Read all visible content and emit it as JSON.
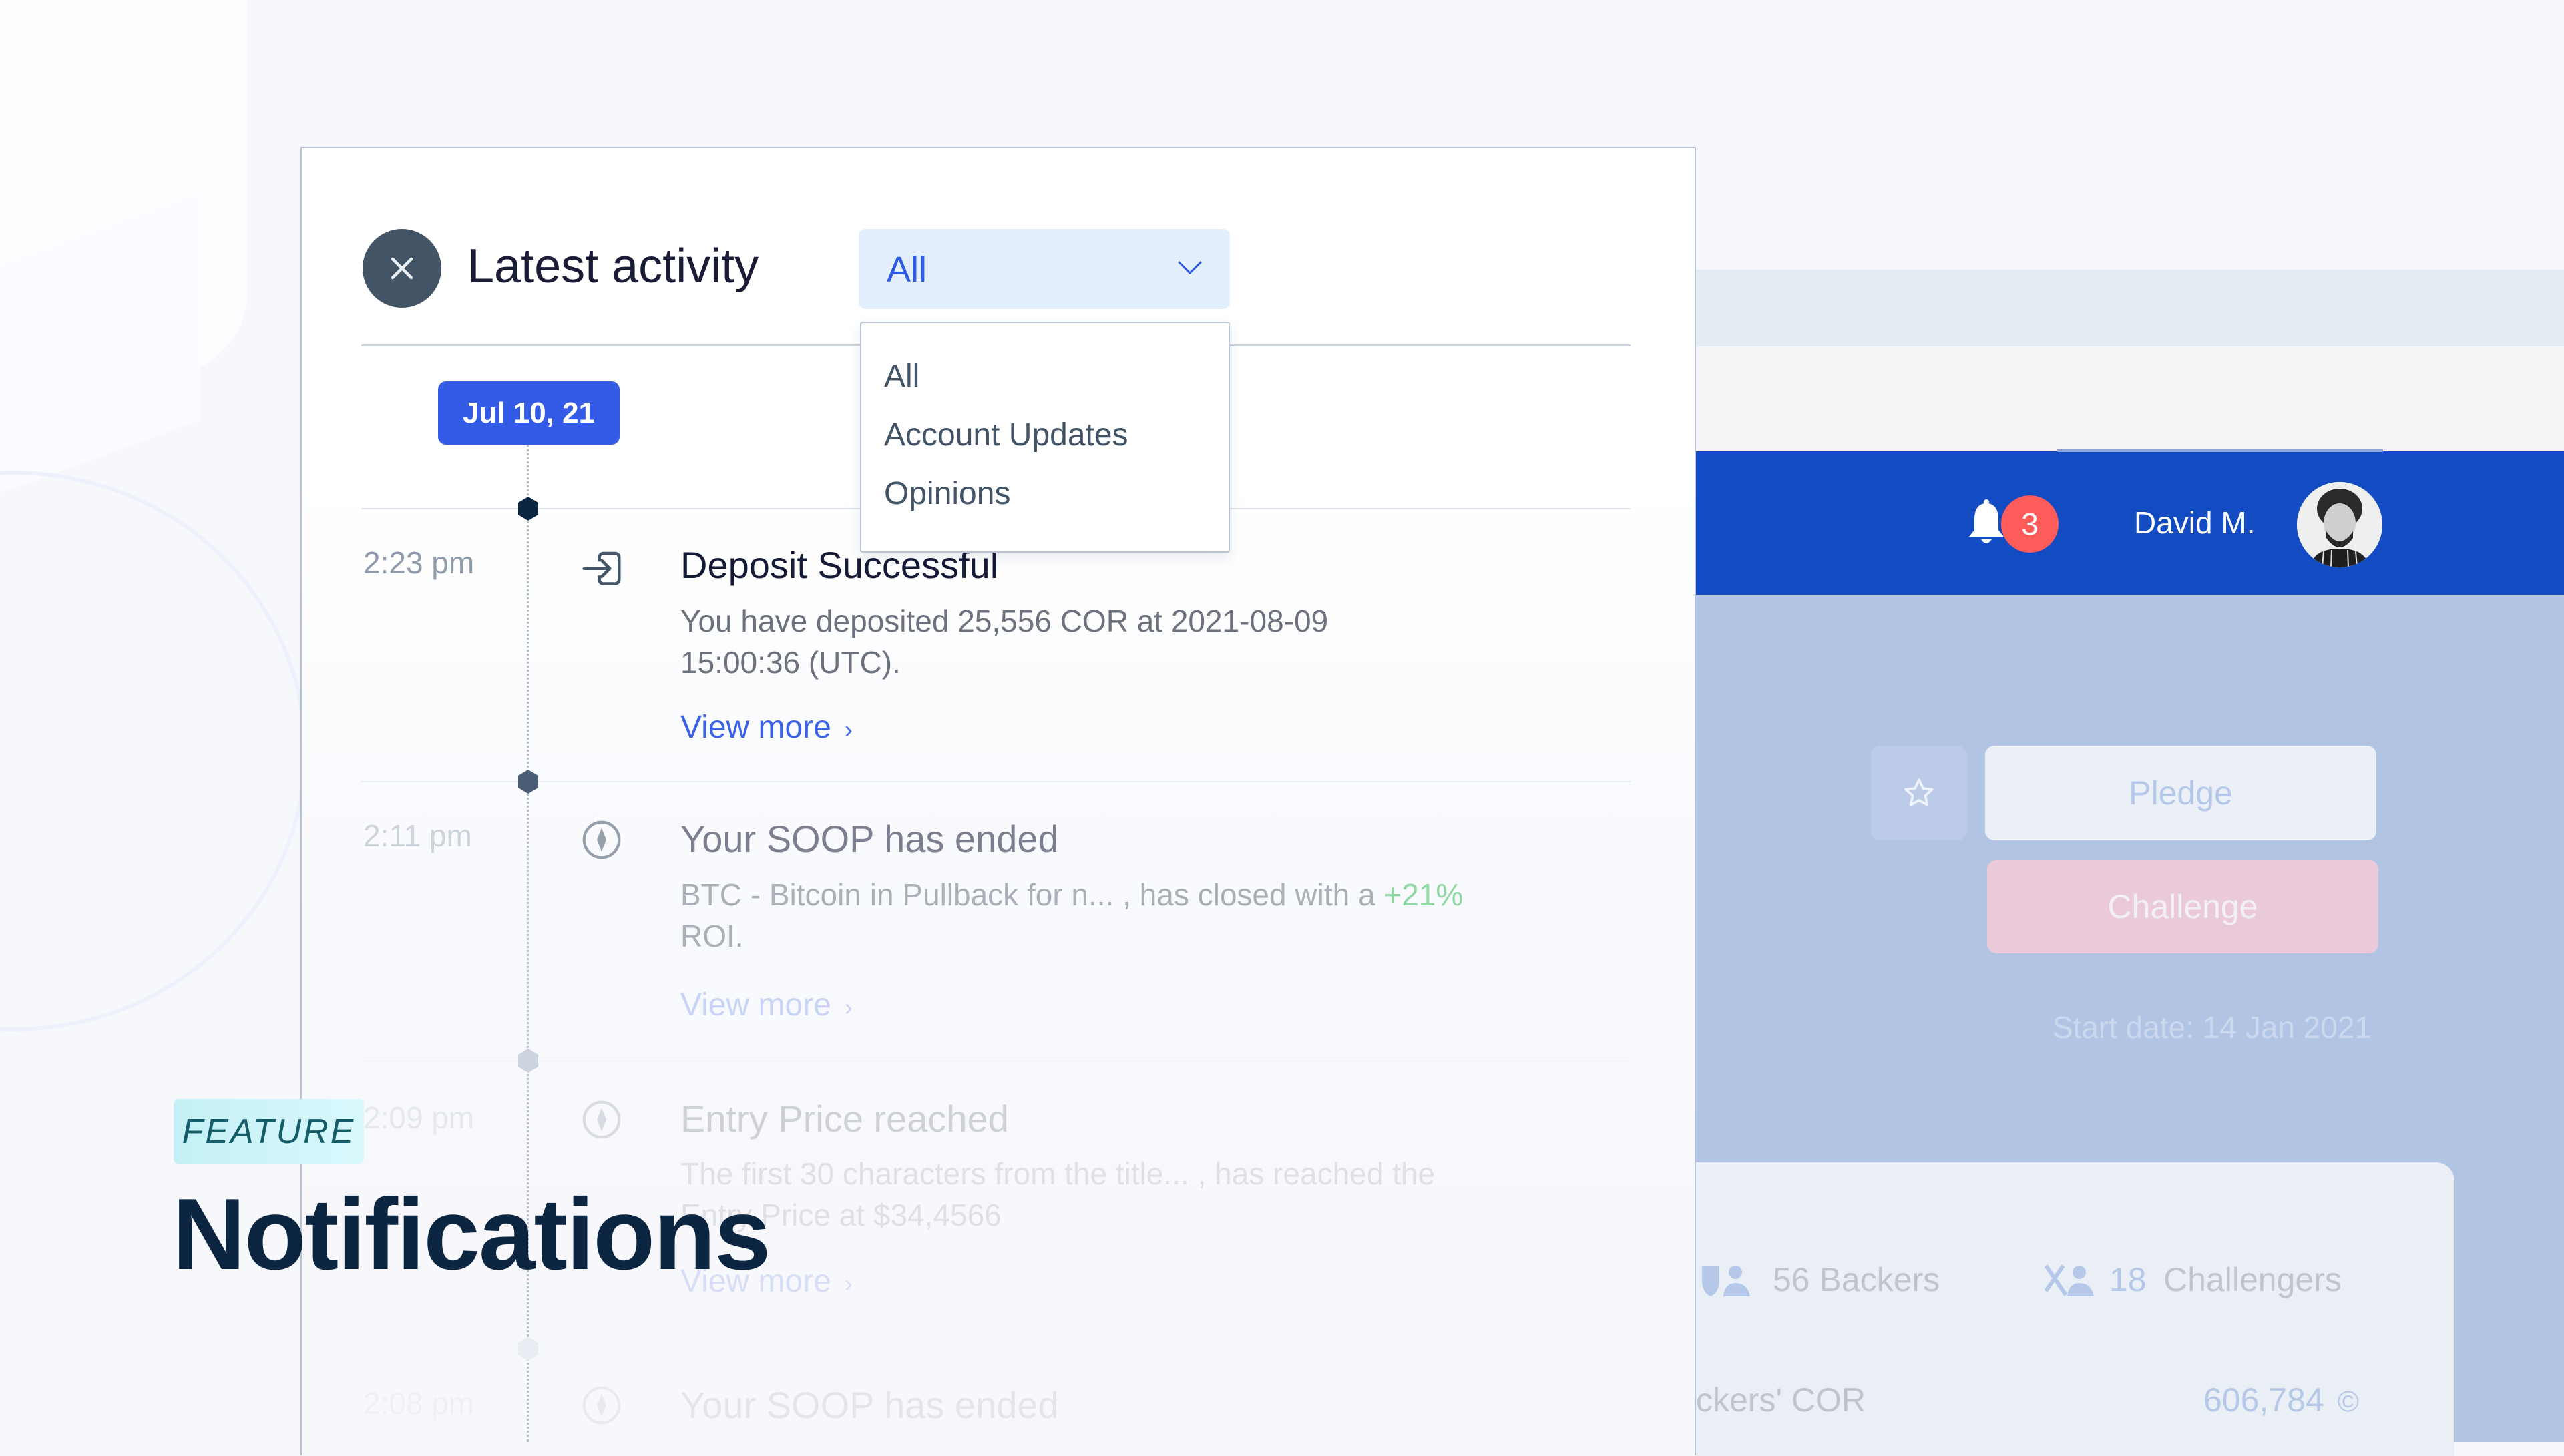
{
  "background_app": {
    "notification_count": "3",
    "user_name": "David M.",
    "buttons": {
      "favorite_icon": "star-icon",
      "pledge": "Pledge",
      "challenge": "Challenge"
    },
    "start_date": "Start date: 14 Jan 2021",
    "stats": {
      "backers_count": "56",
      "backers_label": "Backers",
      "challengers_count": "18",
      "challengers_label": "Challengers",
      "backers_cor_label": "ckers' COR",
      "backers_cor_value": "606,784"
    },
    "colors": {
      "header": "#134bc2",
      "badge": "#fe5b5b",
      "body": "#b1c4e4"
    }
  },
  "panel": {
    "title": "Latest activity",
    "filter": {
      "selected": "All",
      "options": [
        "All",
        "Account Updates",
        "Opinions"
      ]
    },
    "date_label": "Jul 10, 21",
    "items": [
      {
        "time": "2:23 pm",
        "icon": "deposit-login-icon",
        "title": "Deposit Successful",
        "body_lines": [
          "You have deposited 25,556 COR at 2021-08-09",
          "15:00:36 (UTC)."
        ],
        "link": "View more",
        "link_chevron": "›"
      },
      {
        "time": "2:11 pm",
        "icon": "compass-diamond-icon",
        "title": "Your SOOP has ended",
        "body_prefix": "BTC - Bitcoin in Pullback for n... , has closed with a ",
        "body_highlight": "+21%",
        "body_suffix": "ROI.",
        "link": "View more",
        "link_chevron": "›"
      },
      {
        "time": "2:09 pm",
        "icon": "compass-diamond-icon",
        "title": "Entry Price reached",
        "body_lines": [
          "The first 30 characters from the title... , has reached the",
          "Entry Price at $34,4566"
        ],
        "link": "View more",
        "link_chevron": "›"
      },
      {
        "time": "2:08 pm",
        "icon": "compass-diamond-icon",
        "title": "Your SOOP has ended"
      }
    ],
    "colors": {
      "accent": "#345be6",
      "link": "#3b62e4",
      "positive": "#3bbe5a"
    }
  },
  "overlay": {
    "badge": "FEATURE",
    "heading": "Notifications"
  }
}
